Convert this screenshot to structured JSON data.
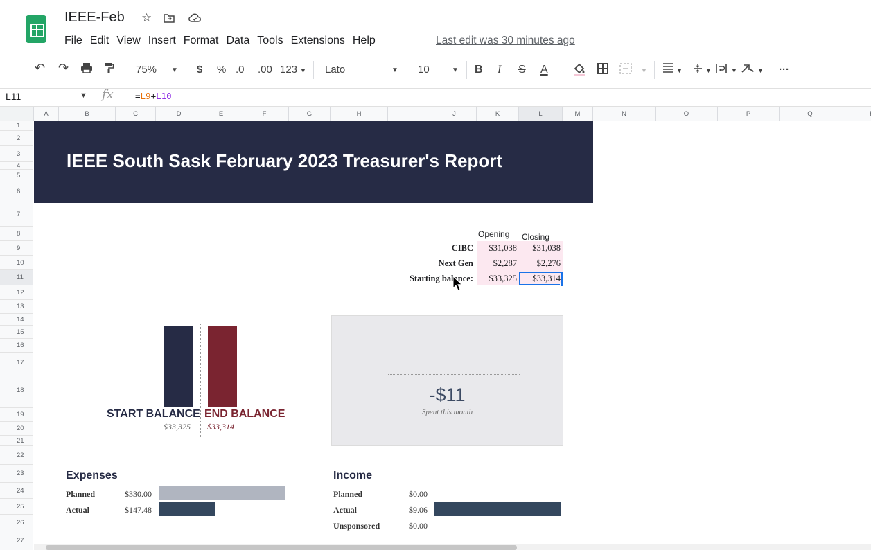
{
  "app": {
    "doc_title": "IEEE-Feb",
    "title_icons": [
      "star-icon",
      "move-to-folder-icon",
      "cloud-status-icon"
    ],
    "menu": [
      "File",
      "Edit",
      "View",
      "Insert",
      "Format",
      "Data",
      "Tools",
      "Extensions",
      "Help"
    ],
    "last_edit": "Last edit was 30 minutes ago"
  },
  "toolbar": {
    "zoom": "75%",
    "currency": "$",
    "percent": "%",
    "dec_decrease": ".0",
    "dec_increase": ".00",
    "format_more": "123",
    "font": "Lato",
    "font_size": "10",
    "bold": "B",
    "italic": "I",
    "strike": "S",
    "text_color": "A",
    "more": "···"
  },
  "formula_bar": {
    "cell_ref": "L11",
    "fx": "fx",
    "eq": "=",
    "ref1": "L9",
    "op": "+",
    "ref2": "L10"
  },
  "grid": {
    "columns": [
      "A",
      "B",
      "C",
      "D",
      "E",
      "F",
      "G",
      "H",
      "I",
      "J",
      "K",
      "L",
      "M",
      "N",
      "O",
      "P",
      "Q",
      "R"
    ],
    "selected_column": "L",
    "rows": [
      "1",
      "2",
      "3",
      "4",
      "5",
      "6",
      "7",
      "8",
      "9",
      "10",
      "11",
      "12",
      "13",
      "14",
      "15",
      "16",
      "17",
      "18",
      "19",
      "20",
      "21",
      "22",
      "23",
      "24",
      "25",
      "26",
      "27"
    ],
    "selected_row": "11"
  },
  "report": {
    "title": "IEEE South Sask February 2023 Treasurer's Report",
    "balance_table": {
      "headers": [
        "Opening",
        "Closing"
      ],
      "rows": [
        {
          "label": "CIBC",
          "opening": "$31,038",
          "closing": "$31,038"
        },
        {
          "label": "Next Gen",
          "opening": "$2,287",
          "closing": "$2,276"
        },
        {
          "label": "Starting balance:",
          "opening": "$33,325",
          "closing": "$33,314"
        }
      ]
    },
    "balance_chart": {
      "start_label": "START BALANCE",
      "end_label": "END BALANCE",
      "start_amount": "$33,325",
      "end_amount": "$33,314",
      "start_color": "#262b45",
      "end_color": "#7a2430"
    },
    "spent": {
      "amount": "-$11",
      "label": "Spent this month"
    },
    "expenses": {
      "title": "Expenses",
      "rows": [
        {
          "label": "Planned",
          "value": "$330.00",
          "fill": 1.0,
          "color": "#b0b5c0"
        },
        {
          "label": "Actual",
          "value": "$147.48",
          "fill": 0.447,
          "color": "#34475e"
        }
      ]
    },
    "income": {
      "title": "Income",
      "rows": [
        {
          "label": "Planned",
          "value": "$0.00",
          "fill": 0.0,
          "color": "#b0b5c0"
        },
        {
          "label": "Actual",
          "value": "$9.06",
          "fill": 1.0,
          "color": "#34475e"
        },
        {
          "label": "Unsponsored",
          "value": "$0.00",
          "fill": 0.0,
          "color": "#b0b5c0"
        }
      ]
    }
  },
  "colors": {
    "sheets_green": "#23a566",
    "banner": "#262b45",
    "selection": "#1a73e8"
  }
}
